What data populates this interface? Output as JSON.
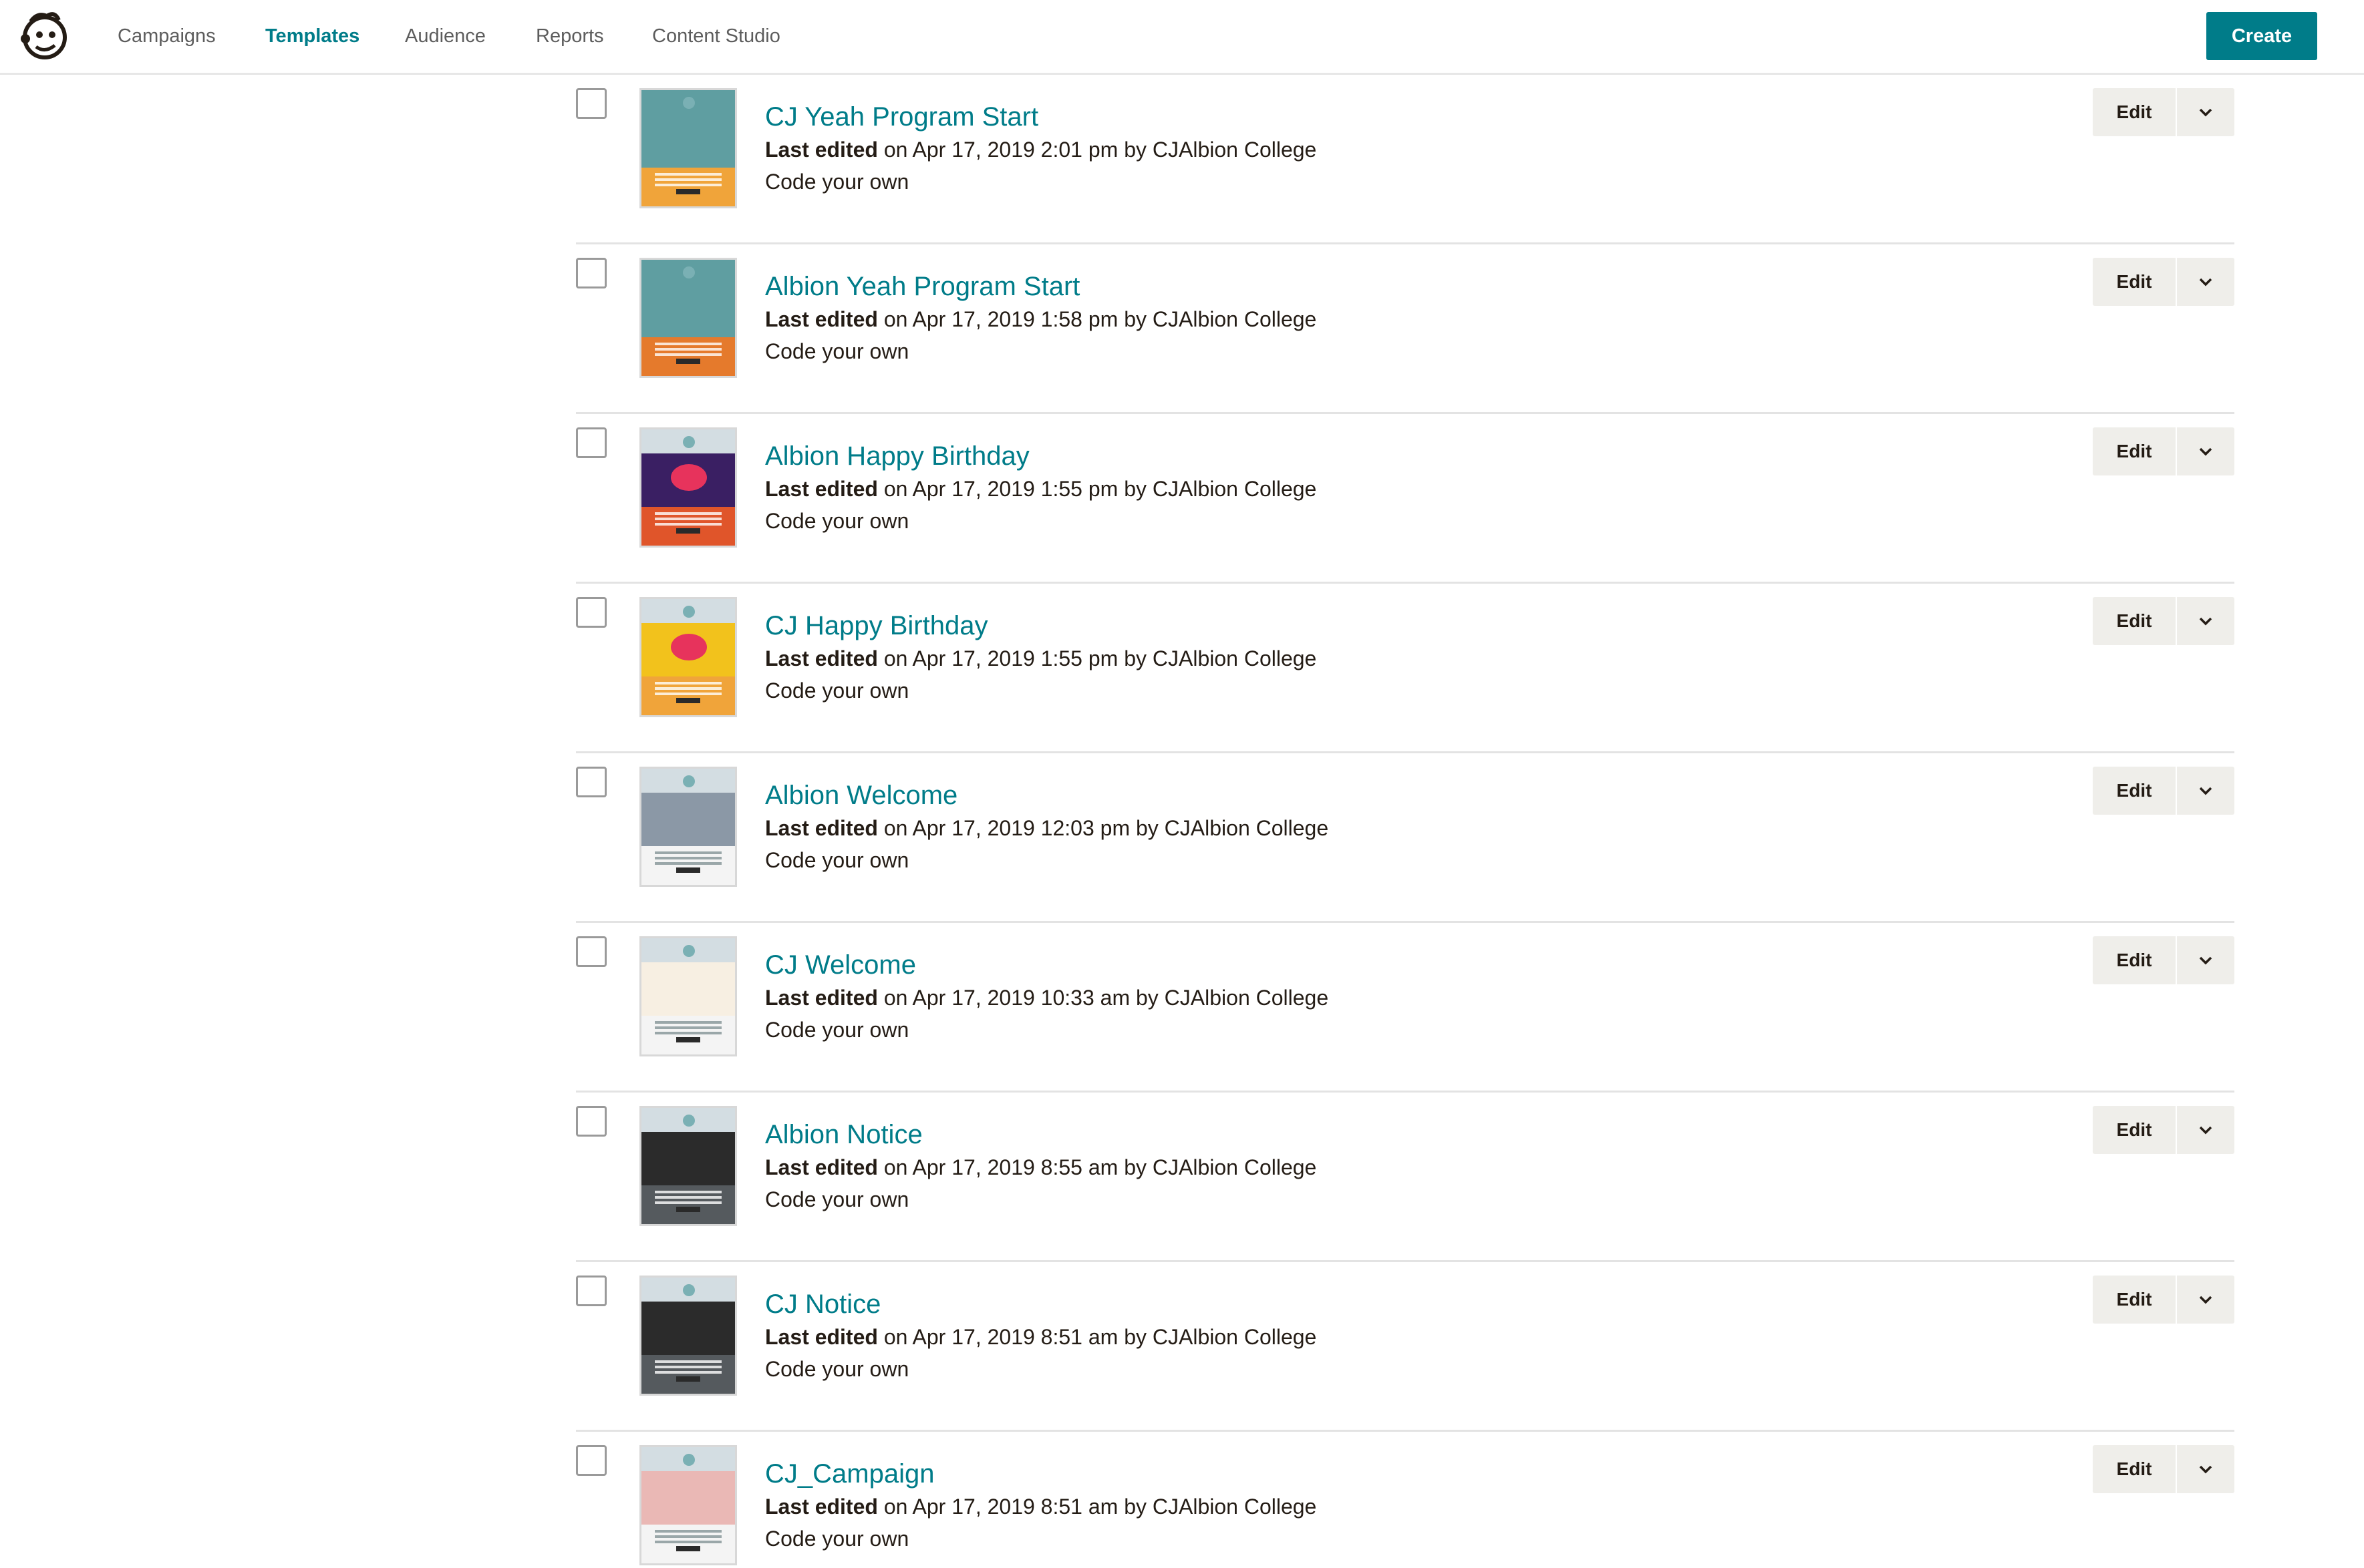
{
  "nav": {
    "items": [
      {
        "label": "Campaigns",
        "active": false
      },
      {
        "label": "Templates",
        "active": true
      },
      {
        "label": "Audience",
        "active": false
      },
      {
        "label": "Reports",
        "active": false
      },
      {
        "label": "Content Studio",
        "active": false
      }
    ],
    "create_label": "Create",
    "logo_icon": "mailchimp-freddie-icon"
  },
  "colors": {
    "accent": "#007c89",
    "button_bg": "#efeeea",
    "text": "#241c15"
  },
  "templates": [
    {
      "name": "CJ Yeah Program Start",
      "edited_label": "Last edited",
      "edited_rest": " on Apr 17, 2019 2:01 pm by CJAlbion College",
      "kind": "Code your own",
      "edit_label": "Edit",
      "thumb_style": "yeah-orange"
    },
    {
      "name": "Albion Yeah Program Start",
      "edited_label": "Last edited",
      "edited_rest": " on Apr 17, 2019 1:58 pm by CJAlbion College",
      "kind": "Code your own",
      "edit_label": "Edit",
      "thumb_style": "yeah-orange-dark"
    },
    {
      "name": "Albion Happy Birthday",
      "edited_label": "Last edited",
      "edited_rest": " on Apr 17, 2019 1:55 pm by CJAlbion College",
      "kind": "Code your own",
      "edit_label": "Edit",
      "thumb_style": "birthday-purple"
    },
    {
      "name": "CJ Happy Birthday",
      "edited_label": "Last edited",
      "edited_rest": " on Apr 17, 2019 1:55 pm by CJAlbion College",
      "kind": "Code your own",
      "edit_label": "Edit",
      "thumb_style": "birthday-yellow"
    },
    {
      "name": "Albion Welcome",
      "edited_label": "Last edited",
      "edited_rest": " on Apr 17, 2019 12:03 pm by CJAlbion College",
      "kind": "Code your own",
      "edit_label": "Edit",
      "thumb_style": "welcome-photo"
    },
    {
      "name": "CJ Welcome",
      "edited_label": "Last edited",
      "edited_rest": " on Apr 17, 2019 10:33 am by CJAlbion College",
      "kind": "Code your own",
      "edit_label": "Edit",
      "thumb_style": "welcome-hello"
    },
    {
      "name": "Albion Notice",
      "edited_label": "Last edited",
      "edited_rest": " on Apr 17, 2019 8:55 am by CJAlbion College",
      "kind": "Code your own",
      "edit_label": "Edit",
      "thumb_style": "notice-dark"
    },
    {
      "name": "CJ Notice",
      "edited_label": "Last edited",
      "edited_rest": " on Apr 17, 2019 8:51 am by CJAlbion College",
      "kind": "Code your own",
      "edit_label": "Edit",
      "thumb_style": "notice-dark"
    },
    {
      "name": "CJ_Campaign",
      "edited_label": "Last edited",
      "edited_rest": " on Apr 17, 2019 8:51 am by CJAlbion College",
      "kind": "Code your own",
      "edit_label": "Edit",
      "thumb_style": "campaign-pink"
    }
  ]
}
